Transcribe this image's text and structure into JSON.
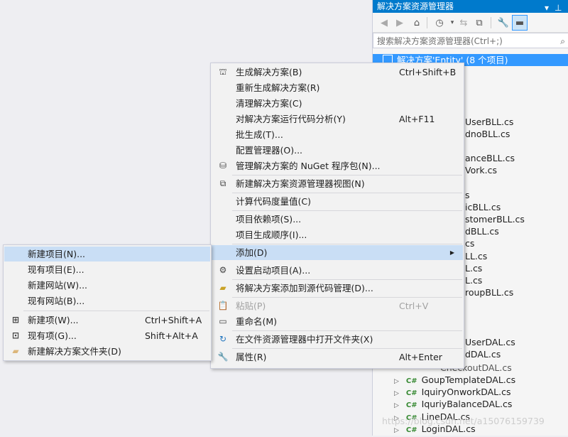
{
  "solution_explorer": {
    "title": "解决方案资源管理器",
    "search_placeholder": "搜索解决方案资源管理器(Ctrl+;)",
    "solution_node": "解决方案'Entity' (8 个项目)",
    "partial_items": [
      "UserBLL.cs",
      "dnoBLL.cs",
      "anceBLL.cs",
      "Vork.cs",
      "s",
      "icBLL.cs",
      "stomerBLL.cs",
      "dBLL.cs",
      "cs",
      "LL.cs",
      "L.cs",
      "L.cs",
      "roupBLL.cs",
      "UserDAL.cs",
      "dDAL.cs",
      "CheckoutDAL.cs"
    ],
    "files": [
      "GoupTemplateDAL.cs",
      "IquiryOnworkDAL.cs",
      "IquriyBalanceDAL.cs",
      "LineDAL.cs",
      "LoginDAL.cs"
    ],
    "cs_badge": "C#"
  },
  "context_menu": {
    "items": [
      {
        "label": "生成解决方案(B)",
        "shortcut": "Ctrl+Shift+B",
        "icon": "build-icon"
      },
      {
        "label": "重新生成解决方案(R)",
        "shortcut": ""
      },
      {
        "label": "清理解决方案(C)",
        "shortcut": ""
      },
      {
        "label": "对解决方案运行代码分析(Y)",
        "shortcut": "Alt+F11"
      },
      {
        "label": "批生成(T)...",
        "shortcut": ""
      },
      {
        "label": "配置管理器(O)...",
        "shortcut": ""
      },
      {
        "label": "管理解决方案的 NuGet 程序包(N)...",
        "shortcut": "",
        "icon": "nuget-icon"
      },
      {
        "label": "新建解决方案资源管理器视图(N)",
        "shortcut": "",
        "icon": "new-view-icon"
      },
      {
        "label": "计算代码度量值(C)",
        "shortcut": ""
      },
      {
        "label": "项目依赖项(S)...",
        "shortcut": ""
      },
      {
        "label": "项目生成顺序(I)...",
        "shortcut": ""
      },
      {
        "label": "添加(D)",
        "shortcut": "",
        "submenu": true
      },
      {
        "label": "设置启动项目(A)...",
        "shortcut": "",
        "icon": "gear-icon"
      },
      {
        "label": "将解决方案添加到源代码管理(D)...",
        "shortcut": "",
        "icon": "source-control-icon"
      },
      {
        "label": "粘贴(P)",
        "shortcut": "Ctrl+V",
        "disabled": true,
        "icon": "paste-icon"
      },
      {
        "label": "重命名(M)",
        "shortcut": "",
        "icon": "rename-icon"
      },
      {
        "label": "在文件资源管理器中打开文件夹(X)",
        "shortcut": "",
        "icon": "open-folder-icon"
      },
      {
        "label": "属性(R)",
        "shortcut": "Alt+Enter",
        "icon": "wrench-icon"
      }
    ]
  },
  "add_submenu": {
    "items": [
      {
        "label": "新建项目(N)...",
        "shortcut": ""
      },
      {
        "label": "现有项目(E)...",
        "shortcut": ""
      },
      {
        "label": "新建网站(W)...",
        "shortcut": ""
      },
      {
        "label": "现有网站(B)...",
        "shortcut": ""
      },
      {
        "label": "新建项(W)...",
        "shortcut": "Ctrl+Shift+A"
      },
      {
        "label": "现有项(G)...",
        "shortcut": "Shift+Alt+A"
      },
      {
        "label": "新建解决方案文件夹(D)",
        "shortcut": ""
      }
    ]
  },
  "watermark": "https://blog.csdn.net/a15076159739"
}
